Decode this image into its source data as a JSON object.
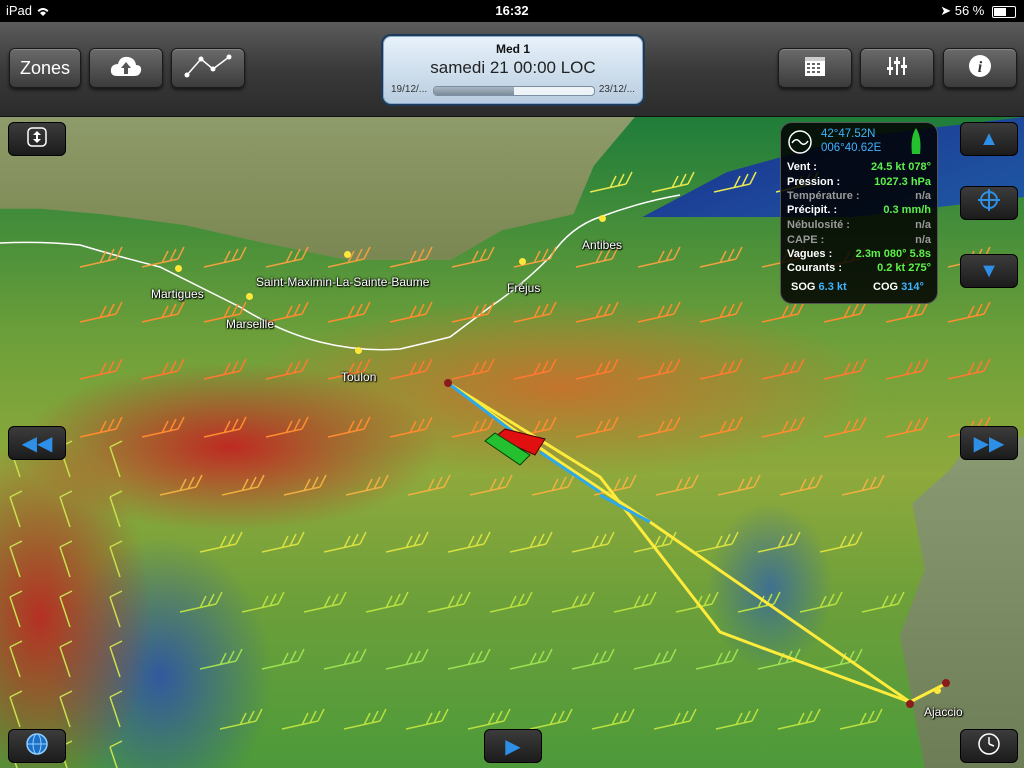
{
  "status_bar": {
    "device": "iPad",
    "time": "16:32",
    "battery": "56 %"
  },
  "toolbar": {
    "zones_label": "Zones",
    "upload_icon": "cloud-upload-icon",
    "route_icon": "route-icon",
    "calendar_icon": "calendar-icon",
    "settings_icon": "sliders-icon",
    "info_icon": "info-icon"
  },
  "date_panel": {
    "model": "Med 1",
    "datetime": "samedi 21 00:00 LOC",
    "start_date": "19/12/...",
    "end_date": "23/12/...",
    "progress": 0.5
  },
  "map": {
    "cities": [
      {
        "name": "Martigues"
      },
      {
        "name": "Saint-Maximin-La-Sainte-Baume"
      },
      {
        "name": "Marseille"
      },
      {
        "name": "Toulon"
      },
      {
        "name": "Fréjus"
      },
      {
        "name": "Antibes"
      },
      {
        "name": "Ajaccio"
      }
    ],
    "colors": {
      "high_wind": "#c8141e",
      "medium_wind": "#dc6428",
      "low_wind": "#6fa03a",
      "calm": "#1e3cc8",
      "route_primary": "#ffeb3b",
      "route_secondary": "#2fa8e8",
      "boat_red": "#e01010",
      "boat_green": "#25c030"
    }
  },
  "info_panel": {
    "lat": "42°47.52N",
    "lon": "006°40.62E",
    "rows": [
      {
        "label": "Vent :",
        "value": "24.5 kt 078°",
        "dim": false
      },
      {
        "label": "Pression :",
        "value": "1027.3 hPa",
        "dim": false
      },
      {
        "label": "Température :",
        "value": "n/a",
        "dim": true
      },
      {
        "label": "Précipit. :",
        "value": "0.3 mm/h",
        "dim": false
      },
      {
        "label": "Nébulosité :",
        "value": "n/a",
        "dim": true
      },
      {
        "label": "CAPE :",
        "value": "n/a",
        "dim": true
      },
      {
        "label": "Vagues :",
        "value": "2.3m 080° 5.8s",
        "dim": false
      },
      {
        "label": "Courants :",
        "value": "0.2 kt 275°",
        "dim": false
      }
    ],
    "sog_label": "SOG",
    "sog_value": "6.3 kt",
    "cog_label": "COG",
    "cog_value": "314°"
  },
  "controls": {
    "expand_icon": "vertical-expand-icon",
    "up_icon": "up-arrow-icon",
    "center_icon": "crosshair-icon",
    "down_icon": "down-arrow-icon",
    "rewind_icon": "rewind-icon",
    "forward_icon": "fast-forward-icon",
    "play_icon": "play-icon",
    "globe_icon": "globe-icon",
    "clock_icon": "clock-icon"
  }
}
